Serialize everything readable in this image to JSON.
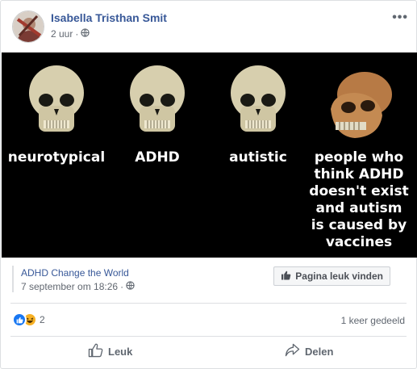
{
  "post": {
    "author": "Isabella Tristhan Smit",
    "time": "2 uur",
    "separator": "·"
  },
  "meme": {
    "captions": [
      "neurotypical",
      "ADHD",
      "autistic",
      "people who\nthink ADHD\ndoesn't exist\nand autism\nis caused by\nvaccines"
    ]
  },
  "shared": {
    "page_name": "ADHD Change the World",
    "date": "7 september om 18:26",
    "separator": "·",
    "like_page_label": "Pagina leuk vinden"
  },
  "stats": {
    "reaction_count": "2",
    "shares": "1 keer gedeeld"
  },
  "actions": {
    "like_label": "Leuk",
    "share_label": "Delen"
  },
  "colors": {
    "link_blue": "#385898",
    "like_blue": "#1877f2",
    "haha_yellow": "#f7b125",
    "meme_bg": "#000000"
  },
  "icons": [
    "globe-icon",
    "more-options-icon",
    "thumbs-up-icon",
    "haha-icon",
    "share-arrow-icon"
  ]
}
